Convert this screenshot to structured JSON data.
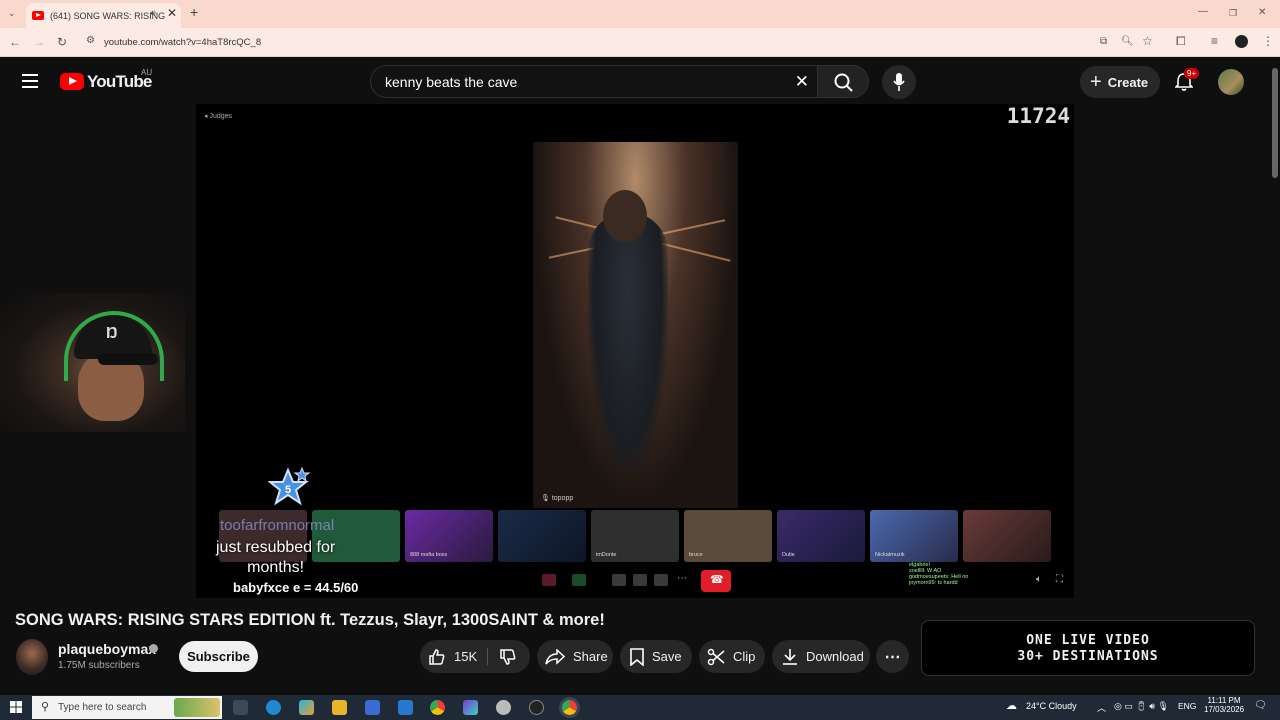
{
  "browser": {
    "tab_title": "(641) SONG WARS: RISING",
    "new_tab_symbol": "+",
    "url": "youtube.com/watch?v=4haT8rcQC_8"
  },
  "youtube": {
    "logo_text": "YouTube",
    "region": "AU",
    "search_query": "kenny beats the cave",
    "create_label": "Create",
    "notifications_badge": "9+"
  },
  "video": {
    "judges_label": "Judges",
    "counter": "11724",
    "phone_caption": "topopp",
    "subtitle_ghost": "toofarfromnormal",
    "subtitle_lines": [
      "just resubbed for",
      "months!"
    ],
    "score_text": "babyfxce e = 44.5/60",
    "star_number": "5",
    "thumb_labels": [
      "",
      "",
      "808 mafia boss",
      "",
      "imDonte",
      "bruce",
      "Dutie",
      "Nickatmuzik",
      ""
    ],
    "chat_lines": [
      "elgabriel",
      "xoelllll: W AO",
      "godmoesupeets: Hell no",
      "joymorn99: ts hardd"
    ]
  },
  "watch": {
    "title": "SONG WARS: RISING STARS EDITION ft. Tezzus, Slayr, 1300SAINT & more!",
    "channel_name": "plaqueboymax",
    "subscribers": "1.75M subscribers",
    "subscribe_label": "Subscribe",
    "likes": "15K",
    "share_label": "Share",
    "save_label": "Save",
    "clip_label": "Clip",
    "download_label": "Download"
  },
  "ad": {
    "line1": "ONE  LIVE  VIDEO",
    "line2": "30+ DESTINATIONS"
  },
  "taskbar": {
    "search_placeholder": "Type here to search",
    "weather": "24°C  Cloudy",
    "language": "ENG",
    "time": "11:11 PM",
    "date": "17/03/2026"
  },
  "colors": {
    "yt_red": "#ff0000",
    "page_bg": "#0f0f0f",
    "chrome_tab_bg": "#f9d9cd",
    "end_call": "#e11d2a"
  }
}
